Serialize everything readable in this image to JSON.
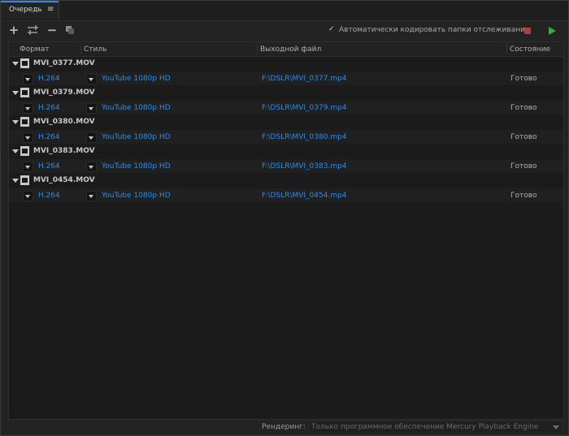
{
  "tab": {
    "label": "Очередь",
    "menu_glyph": "≡"
  },
  "toolbar": {
    "add_icon": "plus-icon",
    "add_source_icon": "add-source-icon",
    "remove_icon": "minus-icon",
    "duplicate_icon": "duplicate-icon",
    "auto_encode_label": "Автоматически кодировать папки отслеживания",
    "auto_encode_checked": true,
    "stop_color": "#b23c3c",
    "start_color": "#2fb33d"
  },
  "columns": {
    "format": "Формат",
    "preset": "Стиль",
    "output": "Выходной файл",
    "status": "Состояние"
  },
  "items": [
    {
      "source": "MVI_0377.MOV",
      "format": "H.264",
      "preset": "YouTube 1080p HD",
      "output": "F:\\DSLR\\MVI_0377.mp4",
      "status": "Готово"
    },
    {
      "source": "MVI_0379.MOV",
      "format": "H.264",
      "preset": "YouTube 1080p HD",
      "output": "F:\\DSLR\\MVI_0379.mp4",
      "status": "Готово"
    },
    {
      "source": "MVI_0380.MOV",
      "format": "H.264",
      "preset": "YouTube 1080p HD",
      "output": "F:\\DSLR\\MVI_0380.mp4",
      "status": "Готово"
    },
    {
      "source": "MVI_0383.MOV",
      "format": "H.264",
      "preset": "YouTube 1080p HD",
      "output": "F:\\DSLR\\MVI_0383.mp4",
      "status": "Готово"
    },
    {
      "source": "MVI_0454.MOV",
      "format": "H.264",
      "preset": "YouTube 1080p HD",
      "output": "F:\\DSLR\\MVI_0454.mp4",
      "status": "Готово"
    }
  ],
  "footer": {
    "render_label": "Рендеринг:",
    "render_value": "Только программное обеспечение Mercury Playback Engine"
  },
  "colors": {
    "accent": "#2d8ceb",
    "background": "#232323"
  }
}
